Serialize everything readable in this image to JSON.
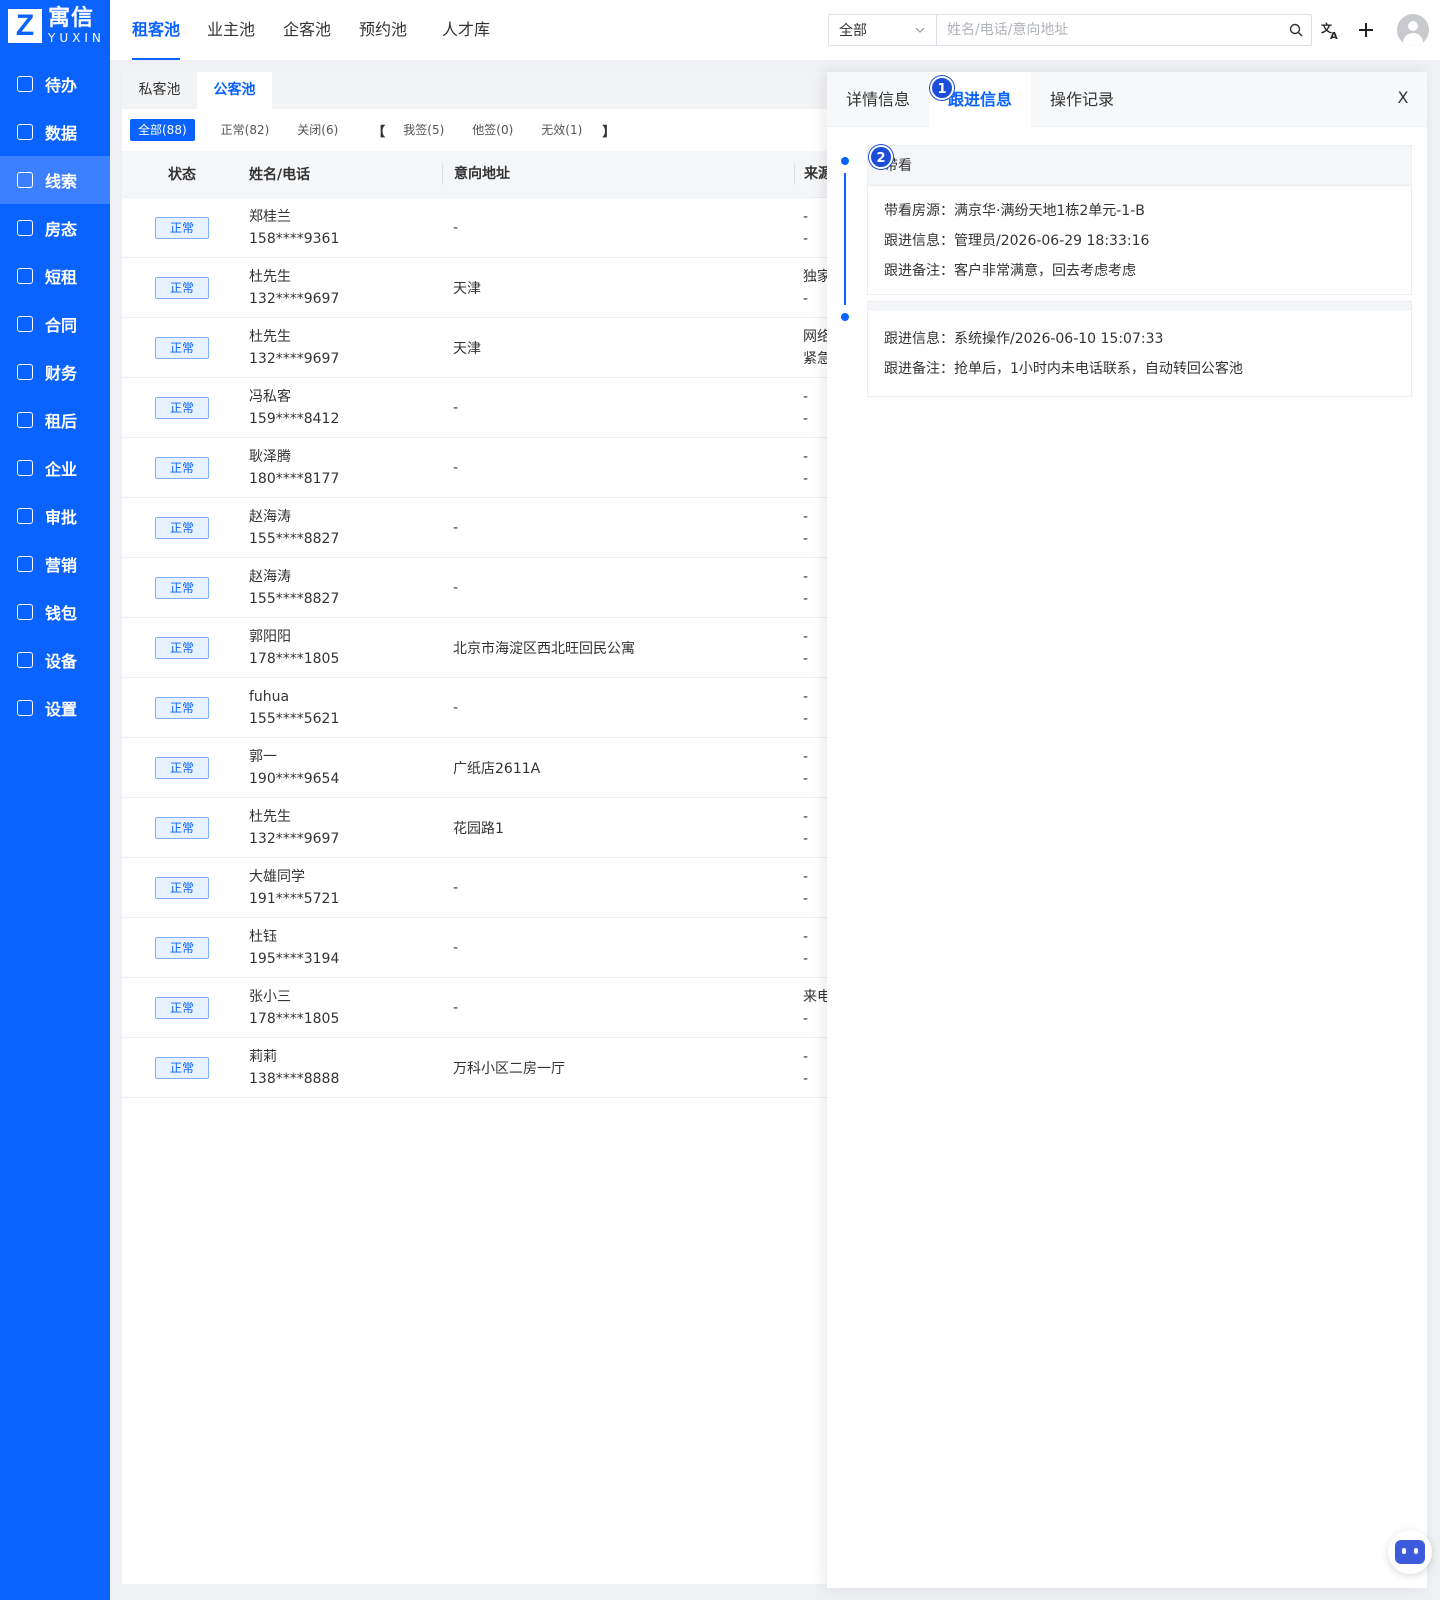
{
  "brand": {
    "logo_cn": "寓信",
    "logo_en": "YUXIN",
    "primary_color": "#0a62ff"
  },
  "sidebar": {
    "items": [
      {
        "label": "待办",
        "icon": "calendar-check-icon"
      },
      {
        "label": "数据",
        "icon": "bar-chart-icon"
      },
      {
        "label": "线索",
        "icon": "clue-icon",
        "active": true
      },
      {
        "label": "房态",
        "icon": "house-icon"
      },
      {
        "label": "短租",
        "icon": "calendar-icon"
      },
      {
        "label": "合同",
        "icon": "contract-icon"
      },
      {
        "label": "财务",
        "icon": "finance-icon"
      },
      {
        "label": "租后",
        "icon": "key-icon"
      },
      {
        "label": "企业",
        "icon": "building-icon"
      },
      {
        "label": "审批",
        "icon": "stamp-icon"
      },
      {
        "label": "营销",
        "icon": "trend-icon"
      },
      {
        "label": "钱包",
        "icon": "wallet-icon"
      },
      {
        "label": "设备",
        "icon": "device-icon"
      },
      {
        "label": "设置",
        "icon": "gear-icon"
      }
    ]
  },
  "header": {
    "tabs": [
      "租客池",
      "业主池",
      "企客池",
      "预约池",
      "人才库"
    ],
    "active_tab": "租客池",
    "search": {
      "scope": "全部",
      "placeholder": "姓名/电话/意向地址"
    }
  },
  "main": {
    "subtabs": [
      "私客池",
      "公客池"
    ],
    "active_subtab": "公客池",
    "filters": {
      "all": "全部(88)",
      "normal": "正常(82)",
      "closed": "关闭(6)",
      "open_bracket": "【",
      "mine": "我签(5)",
      "others": "他签(0)",
      "invalid": "无效(1)",
      "close_bracket": "】"
    },
    "table": {
      "headers": {
        "status": "状态",
        "name": "姓名/电话",
        "address": "意向地址",
        "source": "来源"
      },
      "rows": [
        {
          "status": "正常",
          "name": "郑桂兰",
          "phone": "158****9361",
          "address": "-",
          "src1": "-",
          "src2": "-"
        },
        {
          "status": "正常",
          "name": "杜先生",
          "phone": "132****9697",
          "address": "天津",
          "src1": "独家",
          "src2": "-"
        },
        {
          "status": "正常",
          "name": "杜先生",
          "phone": "132****9697",
          "address": "天津",
          "src1": "网络",
          "src2": "紧急"
        },
        {
          "status": "正常",
          "name": "冯私客",
          "phone": "159****8412",
          "address": "-",
          "src1": "-",
          "src2": "-"
        },
        {
          "status": "正常",
          "name": "耿泽腾",
          "phone": "180****8177",
          "address": "-",
          "src1": "-",
          "src2": "-"
        },
        {
          "status": "正常",
          "name": "赵海涛",
          "phone": "155****8827",
          "address": "-",
          "src1": "-",
          "src2": "-"
        },
        {
          "status": "正常",
          "name": "赵海涛",
          "phone": "155****8827",
          "address": "-",
          "src1": "-",
          "src2": "-"
        },
        {
          "status": "正常",
          "name": "郭阳阳",
          "phone": "178****1805",
          "address": "北京市海淀区西北旺回民公寓",
          "src1": "-",
          "src2": "-"
        },
        {
          "status": "正常",
          "name": "fuhua",
          "phone": "155****5621",
          "address": "-",
          "src1": "-",
          "src2": "-"
        },
        {
          "status": "正常",
          "name": "郭一",
          "phone": "190****9654",
          "address": "广纸店2611A",
          "src1": "-",
          "src2": "-"
        },
        {
          "status": "正常",
          "name": "杜先生",
          "phone": "132****9697",
          "address": "花园路1",
          "src1": "-",
          "src2": "-"
        },
        {
          "status": "正常",
          "name": "大雄同学",
          "phone": "191****5721",
          "address": "-",
          "src1": "-",
          "src2": "-"
        },
        {
          "status": "正常",
          "name": "杜钰",
          "phone": "195****3194",
          "address": "-",
          "src1": "-",
          "src2": "-"
        },
        {
          "status": "正常",
          "name": "张小三",
          "phone": "178****1805",
          "address": "-",
          "src1": "来电",
          "src2": "-"
        },
        {
          "status": "正常",
          "name": "莉莉",
          "phone": "138****8888",
          "address": "万科小区二房一厅",
          "src1": "-",
          "src2": "-"
        }
      ]
    }
  },
  "panel": {
    "tabs": [
      "详情信息",
      "跟进信息",
      "操作记录"
    ],
    "active_tab": "跟进信息",
    "close": "X",
    "markers": [
      "1",
      "2"
    ],
    "records": [
      {
        "title": "带看",
        "lines": [
          "带看房源：满京华·满纷天地1栋2单元-1-B",
          "跟进信息：管理员/2026-06-29 18:33:16",
          "跟进备注：客户非常满意，回去考虑考虑"
        ]
      },
      {
        "title": "",
        "lines": [
          "跟进信息：系统操作/2026-06-10 15:07:33",
          "跟进备注：抢单后，1小时内未电话联系，自动转回公客池"
        ]
      }
    ]
  }
}
